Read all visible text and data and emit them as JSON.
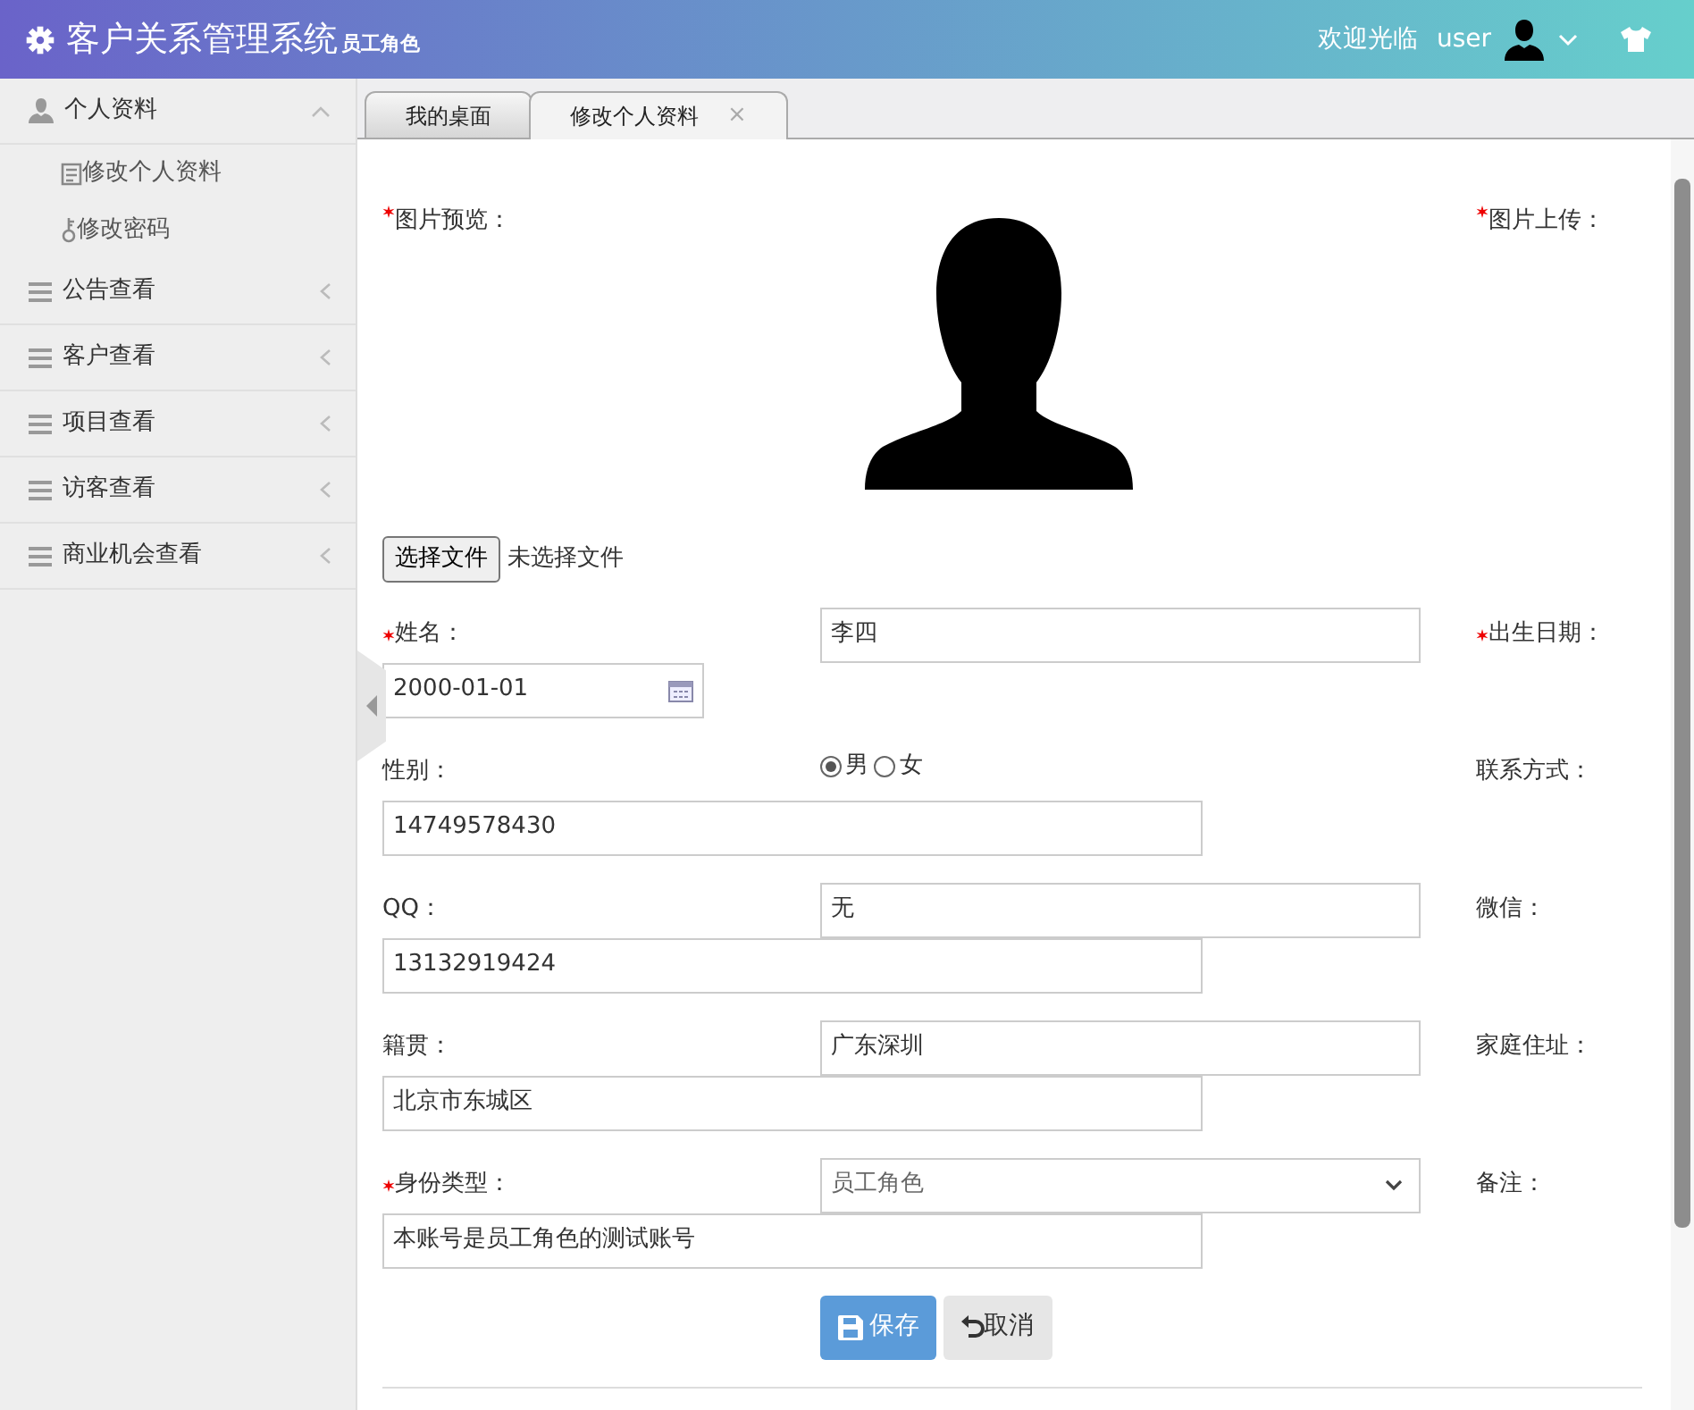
{
  "app": {
    "title": "客户关系管理系统",
    "role": "员工角色",
    "welcome": "欢迎光临",
    "user": "user"
  },
  "sidebar": {
    "items": [
      {
        "label": "个人资料",
        "expanded": true,
        "children": [
          {
            "label": "修改个人资料"
          },
          {
            "label": "修改密码"
          }
        ]
      },
      {
        "label": "公告查看",
        "expanded": false
      },
      {
        "label": "客户查看",
        "expanded": false
      },
      {
        "label": "项目查看",
        "expanded": false
      },
      {
        "label": "访客查看",
        "expanded": false
      },
      {
        "label": "商业机会查看",
        "expanded": false
      }
    ]
  },
  "tabs": [
    {
      "label": "我的桌面",
      "selected": false
    },
    {
      "label": "修改个人资料",
      "selected": true,
      "close": "×"
    }
  ],
  "photo": {
    "preview_label": "图片预览：",
    "upload_label": "图片上传：",
    "required": true,
    "file_button": "选择文件",
    "file_status": "未选择文件"
  },
  "form_items": [
    {
      "kind": "label",
      "text": "姓名：",
      "required": true
    },
    {
      "kind": "text",
      "value": "李四"
    },
    {
      "kind": "label",
      "text": "出生日期：",
      "required": true
    },
    {
      "kind": "date",
      "value": "2000-01-01"
    },
    {
      "kind": "label",
      "text": "性别：",
      "required": false
    },
    {
      "kind": "radio",
      "options": [
        {
          "label": "男",
          "selected": true
        },
        {
          "label": "女",
          "selected": false
        }
      ]
    },
    {
      "kind": "label",
      "text": "联系方式：",
      "required": false
    },
    {
      "kind": "text",
      "value": "14749578430"
    },
    {
      "kind": "label",
      "text": "QQ：",
      "required": false
    },
    {
      "kind": "text",
      "value": "无"
    },
    {
      "kind": "label",
      "text": "微信：",
      "required": false
    },
    {
      "kind": "text",
      "value": "13132919424"
    },
    {
      "kind": "label",
      "text": "籍贯：",
      "required": false
    },
    {
      "kind": "text",
      "value": "广东深圳"
    },
    {
      "kind": "label",
      "text": "家庭住址：",
      "required": false
    },
    {
      "kind": "text",
      "value": "北京市东城区"
    },
    {
      "kind": "label",
      "text": "身份类型：",
      "required": true
    },
    {
      "kind": "select",
      "value": "员工角色"
    },
    {
      "kind": "label",
      "text": "备注：",
      "required": false
    },
    {
      "kind": "text",
      "value": "本账号是员工角色的测试账号"
    }
  ],
  "buttons": [
    {
      "label": "保存",
      "kind": "primary"
    },
    {
      "label": "取消",
      "kind": "secondary"
    }
  ]
}
